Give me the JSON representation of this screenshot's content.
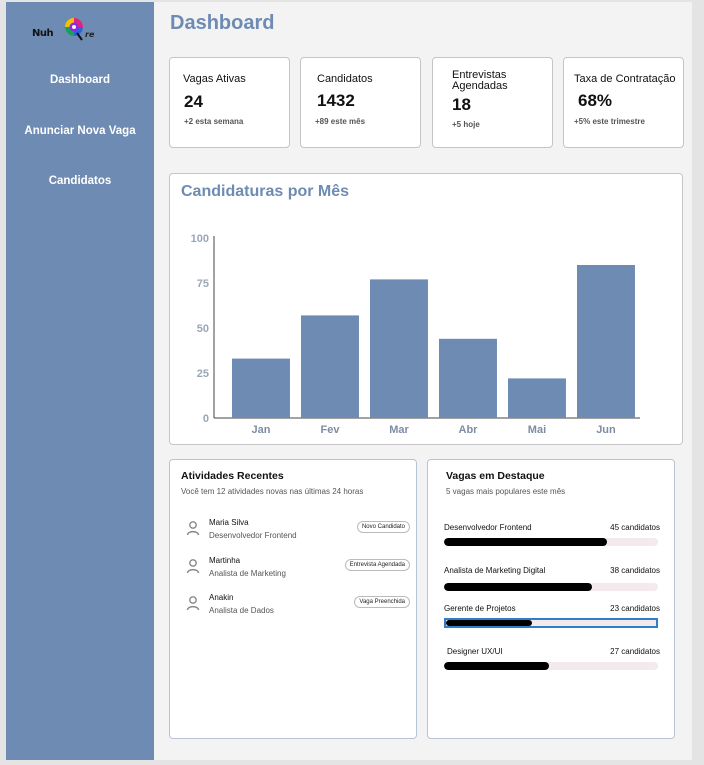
{
  "brand": {
    "logo_text_left": "Nuh",
    "logo_text_right": "re"
  },
  "sidebar": {
    "items": [
      {
        "label": "Dashboard"
      },
      {
        "label": "Anunciar Nova Vaga"
      },
      {
        "label": "Candidatos"
      }
    ]
  },
  "page": {
    "title": "Dashboard"
  },
  "stats": [
    {
      "label": "Vagas Ativas",
      "value": "24",
      "sub": "+2 esta semana"
    },
    {
      "label": "Candidatos",
      "value": "1432",
      "sub": "+89 este mês"
    },
    {
      "label": "Entrevistas Agendadas",
      "label_line1": "Entrevistas",
      "label_line2": "Agendadas",
      "value": "18",
      "sub": "+5 hoje"
    },
    {
      "label": "Taxa de Contratação",
      "value": "68%",
      "sub": "+5% este trimestre"
    }
  ],
  "chart_data": {
    "type": "bar",
    "title": "Candidaturas por Mês",
    "categories": [
      "Jan",
      "Fev",
      "Mar",
      "Abr",
      "Mai",
      "Jun"
    ],
    "values": [
      33,
      57,
      77,
      44,
      22,
      85
    ],
    "ylim": [
      0,
      100
    ],
    "yticks": [
      0,
      25,
      50,
      75,
      100
    ],
    "xlabel": "",
    "ylabel": "",
    "grid": false,
    "bar_color": "#6e8bb3"
  },
  "activities": {
    "title": "Atividades Recentes",
    "subtitle": "Você tem 12 atividades novas nas últimas 24 horas",
    "items": [
      {
        "name": "Maria Silva",
        "role": "Desenvolvedor Frontend",
        "badge": "Novo Candidato"
      },
      {
        "name": "Martinha",
        "role": "Analista de Marketing",
        "badge": "Entrevista Agendada"
      },
      {
        "name": "Anakin",
        "role": "Analista de Dados",
        "badge": "Vaga Preenchida"
      }
    ]
  },
  "featured_jobs": {
    "title": "Vagas em Destaque",
    "subtitle": "5 vagas mais populares este mês",
    "items": [
      {
        "name": "Desenvolvedor Frontend",
        "count": "45 candidatos",
        "progress": 0.76
      },
      {
        "name": "Analista de Marketing Digital",
        "count": "38 candidatos",
        "progress": 0.69
      },
      {
        "name": "Gerente de Projetos",
        "count": "23 candidatos",
        "progress": 0.41
      },
      {
        "name": "Designer UX/UI",
        "count": "27 candidatos",
        "progress": 0.49
      }
    ]
  },
  "colors": {
    "accent": "#6e8bb3",
    "progress_fill": "#000000",
    "progress_track": "#f4e9ec",
    "selection": "#2e7fc7"
  }
}
